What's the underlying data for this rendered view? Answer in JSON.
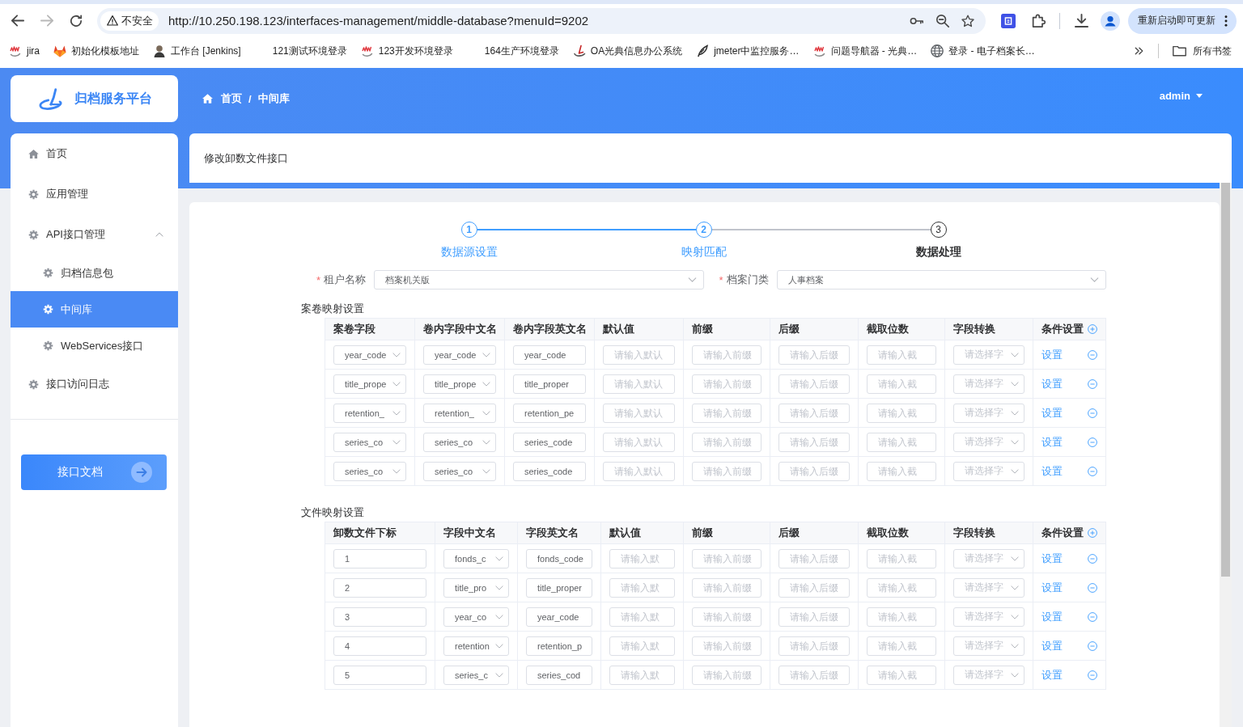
{
  "browser": {
    "nav": [
      {
        "kind": "back",
        "disabled": false
      },
      {
        "kind": "forward",
        "disabled": true
      },
      {
        "kind": "reload",
        "disabled": false
      }
    ],
    "security_label": "不安全",
    "url": "http://10.250.198.123/interfaces-management/middle-database?menuId=9202",
    "update_button": "重新启动即可更新",
    "bookmarks": [
      {
        "kind": "squiggle",
        "label": "jira"
      },
      {
        "kind": "fox",
        "label": "初始化模板地址"
      },
      {
        "kind": "person",
        "label": "工作台 [Jenkins]"
      },
      {
        "kind": "blank",
        "label": "121测试环境登录"
      },
      {
        "kind": "squiggle",
        "label": "123开发环境登录"
      },
      {
        "kind": "blank",
        "label": "164生产环境登录"
      },
      {
        "kind": "swoosh",
        "label": "OA光典信息办公系统"
      },
      {
        "kind": "feather",
        "label": "jmeter中监控服务…"
      },
      {
        "kind": "squiggle",
        "label": "问题导航器 - 光典…"
      },
      {
        "kind": "globe",
        "label": "登录 - 电子档案长…"
      }
    ],
    "all_bookmarks": "所有书签"
  },
  "header": {
    "logo": "归档服务平台",
    "breadcrumb": [
      {
        "kind": "home",
        "label": "首页"
      },
      {
        "kind": "page",
        "label": "中间库"
      }
    ],
    "breadcrumb_separator": "/",
    "user": "admin"
  },
  "sidebar": {
    "items": [
      {
        "kind": "home",
        "label": "首页",
        "selected": false
      },
      {
        "kind": "gear",
        "label": "应用管理",
        "selected": false
      },
      {
        "kind": "gear",
        "label": "API接口管理",
        "selected": false,
        "expanded": true,
        "children": [
          {
            "kind": "gear",
            "label": "归档信息包",
            "selected": false
          },
          {
            "kind": "gear",
            "label": "中间库",
            "selected": true
          },
          {
            "kind": "gear",
            "label": "WebServices接口",
            "selected": false
          }
        ]
      },
      {
        "kind": "gear",
        "label": "接口访问日志",
        "selected": false
      }
    ],
    "doc_button": "接口文档"
  },
  "page_title": "修改卸数文件接口",
  "steps": [
    {
      "number": "1",
      "label": "数据源设置",
      "done": true,
      "active": false
    },
    {
      "number": "2",
      "label": "映射匹配",
      "done": true,
      "active": false
    },
    {
      "number": "3",
      "label": "数据处理",
      "done": false,
      "active": true
    }
  ],
  "form": [
    {
      "required_mark": "*",
      "label": "租户名称",
      "value": "档案机关版"
    },
    {
      "required_mark": "*",
      "label": "档案门类",
      "value": "人事档案"
    }
  ],
  "tables": [
    {
      "title": "案卷映射设置",
      "kind": "archive",
      "columns": [
        {
          "kind": "text",
          "label": "案卷字段"
        },
        {
          "kind": "text",
          "label": "卷内字段中文名"
        },
        {
          "kind": "text",
          "label": "卷内字段英文名"
        },
        {
          "kind": "text",
          "label": "默认值"
        },
        {
          "kind": "text",
          "label": "前缀"
        },
        {
          "kind": "text",
          "label": "后缀"
        },
        {
          "kind": "text",
          "label": "截取位数"
        },
        {
          "kind": "text",
          "label": "字段转换"
        },
        {
          "kind": "add",
          "label": "条件设置"
        }
      ],
      "rows": [
        {
          "cells": [
            {
              "kind": "select",
              "value": "year_code"
            },
            {
              "kind": "select",
              "value": "year_code"
            },
            {
              "kind": "input",
              "value": "year_code"
            },
            {
              "kind": "input",
              "placeholder": "请输入默认"
            },
            {
              "kind": "input",
              "placeholder": "请输入前缀"
            },
            {
              "kind": "input",
              "placeholder": "请输入后缀"
            },
            {
              "kind": "input",
              "placeholder": "请输入截"
            },
            {
              "kind": "select",
              "placeholder": "请选择字"
            },
            {
              "kind": "actions",
              "link": "设置"
            }
          ]
        },
        {
          "cells": [
            {
              "kind": "select",
              "value": "title_prope"
            },
            {
              "kind": "select",
              "value": "title_prope"
            },
            {
              "kind": "input",
              "value": "title_proper"
            },
            {
              "kind": "input",
              "placeholder": "请输入默认"
            },
            {
              "kind": "input",
              "placeholder": "请输入前缀"
            },
            {
              "kind": "input",
              "placeholder": "请输入后缀"
            },
            {
              "kind": "input",
              "placeholder": "请输入截"
            },
            {
              "kind": "select",
              "placeholder": "请选择字"
            },
            {
              "kind": "actions",
              "link": "设置"
            }
          ]
        },
        {
          "cells": [
            {
              "kind": "select",
              "value": "retention_"
            },
            {
              "kind": "select",
              "value": "retention_"
            },
            {
              "kind": "input",
              "value": "retention_pe"
            },
            {
              "kind": "input",
              "placeholder": "请输入默认"
            },
            {
              "kind": "input",
              "placeholder": "请输入前缀"
            },
            {
              "kind": "input",
              "placeholder": "请输入后缀"
            },
            {
              "kind": "input",
              "placeholder": "请输入截"
            },
            {
              "kind": "select",
              "placeholder": "请选择字"
            },
            {
              "kind": "actions",
              "link": "设置"
            }
          ]
        },
        {
          "cells": [
            {
              "kind": "select",
              "value": "series_co"
            },
            {
              "kind": "select",
              "value": "series_co"
            },
            {
              "kind": "input",
              "value": "series_code"
            },
            {
              "kind": "input",
              "placeholder": "请输入默认"
            },
            {
              "kind": "input",
              "placeholder": "请输入前缀"
            },
            {
              "kind": "input",
              "placeholder": "请输入后缀"
            },
            {
              "kind": "input",
              "placeholder": "请输入截"
            },
            {
              "kind": "select",
              "placeholder": "请选择字"
            },
            {
              "kind": "actions",
              "link": "设置"
            }
          ]
        },
        {
          "cells": [
            {
              "kind": "select",
              "value": "series_co"
            },
            {
              "kind": "select",
              "value": "series_co"
            },
            {
              "kind": "input",
              "value": "series_code"
            },
            {
              "kind": "input",
              "placeholder": "请输入默认"
            },
            {
              "kind": "input",
              "placeholder": "请输入前缀"
            },
            {
              "kind": "input",
              "placeholder": "请输入后缀"
            },
            {
              "kind": "input",
              "placeholder": "请输入截"
            },
            {
              "kind": "select",
              "placeholder": "请选择字"
            },
            {
              "kind": "actions",
              "link": "设置"
            }
          ]
        }
      ]
    },
    {
      "title": "文件映射设置",
      "kind": "file",
      "columns": [
        {
          "kind": "text",
          "label": "卸数文件下标"
        },
        {
          "kind": "text",
          "label": "字段中文名"
        },
        {
          "kind": "text",
          "label": "字段英文名"
        },
        {
          "kind": "text",
          "label": "默认值"
        },
        {
          "kind": "text",
          "label": "前缀"
        },
        {
          "kind": "text",
          "label": "后缀"
        },
        {
          "kind": "text",
          "label": "截取位数"
        },
        {
          "kind": "text",
          "label": "字段转换"
        },
        {
          "kind": "add",
          "label": "条件设置"
        }
      ],
      "rows": [
        {
          "cells": [
            {
              "kind": "input",
              "value": "1"
            },
            {
              "kind": "select",
              "value": "fonds_c"
            },
            {
              "kind": "input",
              "value": "fonds_code"
            },
            {
              "kind": "input",
              "placeholder": "请输入默"
            },
            {
              "kind": "input",
              "placeholder": "请输入前缀"
            },
            {
              "kind": "input",
              "placeholder": "请输入后缀"
            },
            {
              "kind": "input",
              "placeholder": "请输入截"
            },
            {
              "kind": "select",
              "placeholder": "请选择字"
            },
            {
              "kind": "actions",
              "link": "设置"
            }
          ]
        },
        {
          "cells": [
            {
              "kind": "input",
              "value": "2"
            },
            {
              "kind": "select",
              "value": "title_pro"
            },
            {
              "kind": "input",
              "value": "title_proper"
            },
            {
              "kind": "input",
              "placeholder": "请输入默"
            },
            {
              "kind": "input",
              "placeholder": "请输入前缀"
            },
            {
              "kind": "input",
              "placeholder": "请输入后缀"
            },
            {
              "kind": "input",
              "placeholder": "请输入截"
            },
            {
              "kind": "select",
              "placeholder": "请选择字"
            },
            {
              "kind": "actions",
              "link": "设置"
            }
          ]
        },
        {
          "cells": [
            {
              "kind": "input",
              "value": "3"
            },
            {
              "kind": "select",
              "value": "year_co"
            },
            {
              "kind": "input",
              "value": "year_code"
            },
            {
              "kind": "input",
              "placeholder": "请输入默"
            },
            {
              "kind": "input",
              "placeholder": "请输入前缀"
            },
            {
              "kind": "input",
              "placeholder": "请输入后缀"
            },
            {
              "kind": "input",
              "placeholder": "请输入截"
            },
            {
              "kind": "select",
              "placeholder": "请选择字"
            },
            {
              "kind": "actions",
              "link": "设置"
            }
          ]
        },
        {
          "cells": [
            {
              "kind": "input",
              "value": "4"
            },
            {
              "kind": "select",
              "value": "retention"
            },
            {
              "kind": "input",
              "value": "retention_p"
            },
            {
              "kind": "input",
              "placeholder": "请输入默"
            },
            {
              "kind": "input",
              "placeholder": "请输入前缀"
            },
            {
              "kind": "input",
              "placeholder": "请输入后缀"
            },
            {
              "kind": "input",
              "placeholder": "请输入截"
            },
            {
              "kind": "select",
              "placeholder": "请选择字"
            },
            {
              "kind": "actions",
              "link": "设置"
            }
          ]
        },
        {
          "cells": [
            {
              "kind": "input",
              "value": "5"
            },
            {
              "kind": "select",
              "value": "series_c"
            },
            {
              "kind": "input",
              "value": "series_cod"
            },
            {
              "kind": "input",
              "placeholder": "请输入默"
            },
            {
              "kind": "input",
              "placeholder": "请输入前缀"
            },
            {
              "kind": "input",
              "placeholder": "请输入后缀"
            },
            {
              "kind": "input",
              "placeholder": "请输入截"
            },
            {
              "kind": "select",
              "placeholder": "请选择字"
            },
            {
              "kind": "actions",
              "link": "设置"
            }
          ]
        }
      ]
    }
  ]
}
